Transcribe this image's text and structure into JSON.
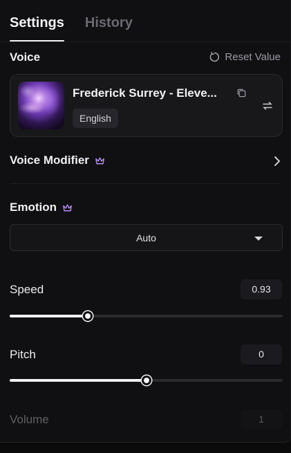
{
  "tabs": [
    {
      "label": "Settings",
      "active": true
    },
    {
      "label": "History",
      "active": false
    }
  ],
  "voice": {
    "title": "Voice",
    "reset_label": "Reset Value",
    "name": "Frederick Surrey - Eleve...",
    "language": "English"
  },
  "voice_modifier": {
    "label": "Voice Modifier",
    "premium_icon": "crown-icon"
  },
  "emotion": {
    "label": "Emotion",
    "premium_icon": "crown-icon",
    "selected": "Auto"
  },
  "speed": {
    "label": "Speed",
    "value": "0.93",
    "fraction": 0.285
  },
  "pitch": {
    "label": "Pitch",
    "value": "0",
    "fraction": 0.5
  },
  "volume": {
    "label": "Volume",
    "value": "1"
  },
  "colors": {
    "background": "#101012",
    "accent": "#b98cf0",
    "text": "#f0f0f2"
  }
}
